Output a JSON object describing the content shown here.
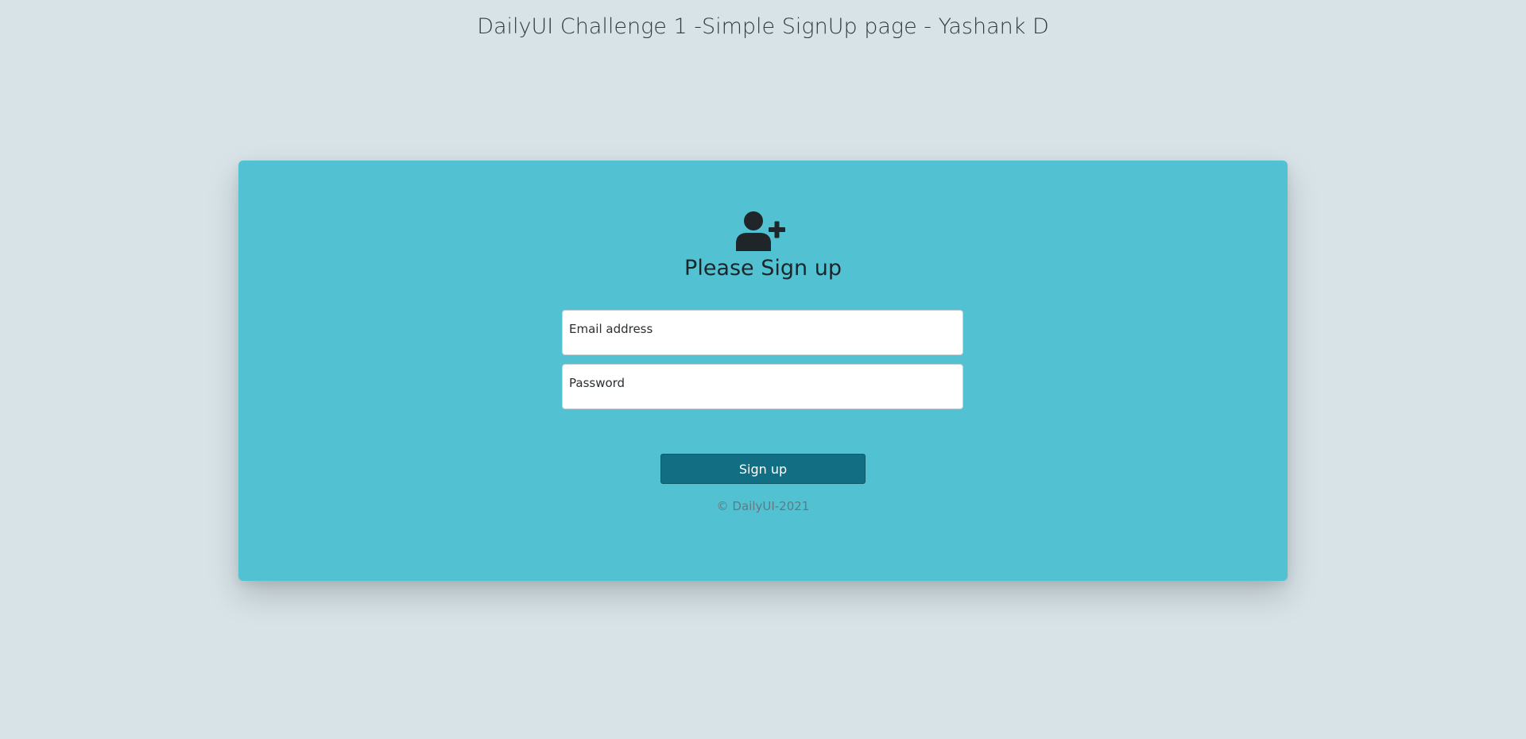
{
  "page": {
    "heading": "DailyUI Challenge 1 -Simple SignUp page - Yashank D"
  },
  "signup_card": {
    "icon": "user-plus-icon",
    "title": "Please Sign up",
    "email": {
      "label": "Email address",
      "value": ""
    },
    "password": {
      "label": "Password",
      "value": ""
    },
    "submit_label": "Sign up",
    "copyright": "© DailyUI-2021"
  },
  "colors": {
    "page_background": "#d7e3e7",
    "card_background": "#52c2d3",
    "button_background": "#126e82",
    "text_dark": "#1c2529"
  }
}
